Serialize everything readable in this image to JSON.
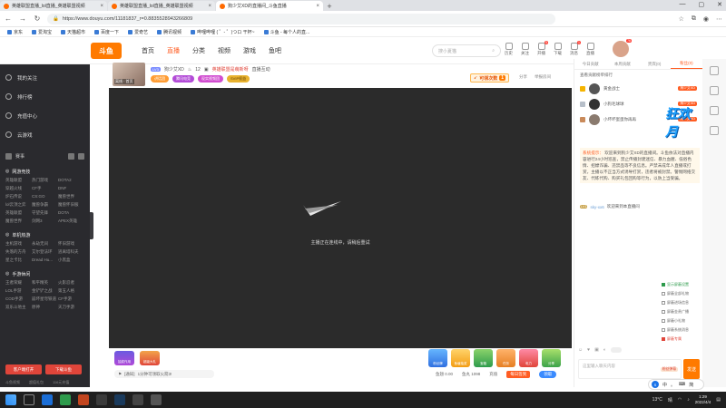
{
  "browser": {
    "tabs": [
      {
        "title": "英雄联盟直播_lol直播_英雄联盟视频"
      },
      {
        "title": "英雄联盟直播_lol直播_英雄联盟视频"
      },
      {
        "title": "狗少艾XD的直播间_斗鱼直播"
      }
    ],
    "url": "https://www.douyu.com/11181837_r=0.8835528943266809",
    "bookmarks": [
      "京东",
      "爱淘宝",
      "天猫超市",
      "百度一下",
      "爱奇艺",
      "腾讯视频",
      "哔哩哔哩 ( ゜- ゜)つロ 干杯~",
      "斗鱼 - 每个人的直..."
    ]
  },
  "header": {
    "logo": "斗鱼",
    "nav": [
      "首页",
      "直播",
      "分类",
      "视频",
      "游戏",
      "鱼吧"
    ],
    "active_nav": "直播",
    "search_placeholder": "搜小夏猫",
    "icons": [
      {
        "name": "history",
        "label": "历史"
      },
      {
        "name": "follow",
        "label": "关注"
      },
      {
        "name": "open-live",
        "label": "开播",
        "badge": "5"
      },
      {
        "name": "download",
        "label": "下载"
      },
      {
        "name": "message",
        "label": "消息",
        "badge": "1"
      },
      {
        "name": "live-entry",
        "label": "直播"
      }
    ],
    "avatar_badge": "76"
  },
  "sidebar": {
    "top_items": [
      "我的关注",
      "排行榜",
      "充值中心",
      "云游戏"
    ],
    "quick_row": [
      "赛事"
    ],
    "sections": [
      {
        "title": "网游竞技",
        "items": [
          "英雄联盟",
          "热门游戏",
          "DOTA2",
          "穿越火线",
          "CF手",
          "DNF",
          "炉石传说",
          "CS:GO",
          "魔兽世界",
          "lol云顶之弈",
          "魔兽争霸",
          "魔兽怀旧服",
          "英雄联盟",
          "守望先锋",
          "DOTA",
          "魔兽世界",
          "剑网3",
          "APEX英雄"
        ]
      },
      {
        "title": "单机热游",
        "items": [
          "主机游戏",
          "永劫无间",
          "怀旧游戏",
          "失落的方舟",
          "艾尔登法环",
          "逃离塔科夫",
          "星之卡比",
          "Dread Hu...",
          "小黑盒"
        ]
      },
      {
        "title": "手游休闲",
        "items": [
          "王者荣耀",
          "和平精英",
          "火影忍者",
          "LOL手游",
          "金铲铲之战",
          "第五人格",
          "COD手游",
          "崩坏星穹铁道",
          "CF手游",
          "双乐斗地主",
          "原神",
          "天刀手游"
        ]
      }
    ],
    "buttons": [
      "客户端打开",
      "下载斗鱼"
    ],
    "footer": [
      "斗鱼视频",
      "超值礼包",
      "116元充值"
    ]
  },
  "room": {
    "thumb_label": "离线 · 首页",
    "anchor_level": "LV3",
    "anchor_name": "狗少艾XD",
    "popularity": "12",
    "room_link": "英雄联盟是萌新呀",
    "report": "直播互动",
    "badges": [
      "讲话团",
      "腾讯电竞",
      "现实视频团",
      "SVIP权益"
    ],
    "task_label": "可领次数",
    "task_count": "1",
    "share": "分享",
    "report_room": "举报房间",
    "player_message": "主播正在连线中，请稍后重试"
  },
  "giftbar": {
    "left_gifts": [
      "抽奖作用",
      "超级大礼"
    ],
    "notice_prefix": "[通知]",
    "notice_text": "1分钟可领取火箭3!",
    "right_gifts": [
      "粉丝牌",
      "鱼塘抽奖",
      "宝箱",
      "任务",
      "电力",
      "分享"
    ],
    "balance_label": "鱼翅 0.00",
    "fish_count": "鱼丸 1098",
    "recharge": "充值",
    "button_a": "每日签到",
    "button_b": "领取"
  },
  "rightpanel": {
    "tabs": [
      "今日贡献",
      "本周贡献",
      "贵宾(0)",
      "粉丝(0)"
    ],
    "active_tab": "粉丝(0)",
    "rank_title": "查看贡献榜单排行",
    "ranks": [
      {
        "name": "黄金战士",
        "tag": "狗少艾XD"
      },
      {
        "name": "小狗毛球球",
        "tag": "狗少艾XD"
      },
      {
        "name": "小坏坏蛋蛋你再再",
        "tag": "狗少艾XD"
      }
    ],
    "promo": "狂欢月",
    "notice_head": "系统提示：",
    "notice_body": "欢迎来到狗少艾XD的直播间。斗鱼依法对直播内容进行24小时巡查，禁止传播封建迷信、暴力血腥、低俗色情、招嫖诈骗、违禁品等不良信息。严禁未成年人直播或打赏，主播以不正当方式诱导打赏，违者将被封禁。警惕网络交友、代练代购、购买礼包回购等行为，以防上当受骗。",
    "welcome_level": "LV1",
    "welcome_user": "sky-xx6",
    "welcome_text": "欢迎来到本直播间",
    "options": [
      {
        "label": "屏蔽全部礼物",
        "checked": false
      },
      {
        "label": "屏蔽进场信息",
        "checked": false
      },
      {
        "label": "屏蔽金贵广播",
        "checked": false
      },
      {
        "label": "屏蔽小礼物",
        "checked": false
      },
      {
        "label": "屏蔽系统消息",
        "checked": false
      },
      {
        "label": "屏蔽专属",
        "checked": true
      }
    ],
    "highlight_option": "屏蔽专属",
    "option_header": "显示屏蔽设置",
    "chat_placeholder": "这里输入聊天内容",
    "chat_small": "粉丝弹幕",
    "send": "发送"
  },
  "taskbar": {
    "temp": "13°C",
    "status": "晴",
    "time": "1:29",
    "date": "2022/4/4",
    "ime": [
      "中",
      "。",
      "简"
    ]
  }
}
